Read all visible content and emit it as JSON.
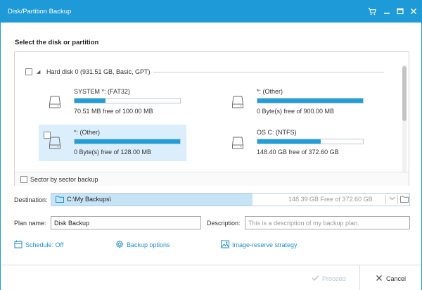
{
  "window": {
    "title": "Disk/Partition Backup",
    "accent_color": "#1d9ad7",
    "controls": [
      "cart-icon",
      "minimize-icon",
      "maximize-icon",
      "close-icon"
    ]
  },
  "section_title": "Select the disk or partition",
  "disk": {
    "label": "Hard disk 0 (931.51 GB, Basic, GPT)",
    "partitions": [
      {
        "name": "SYSTEM *: (FAT32)",
        "free": "70.51 MB free of 100.00 MB",
        "used_fraction": 0.29,
        "selected": false
      },
      {
        "name": "*: (Other)",
        "free": "0 Byte(s) free of 900.00 MB",
        "used_fraction": 1.0,
        "selected": false
      },
      {
        "name": "*: (Other)",
        "free": "0 Byte(s) free of 128.00 MB",
        "used_fraction": 1.0,
        "selected": true
      },
      {
        "name": "OS C: (NTFS)",
        "free": "148.40 GB free of 372.60 GB",
        "used_fraction": 0.6,
        "selected": false
      }
    ]
  },
  "sector_backup_label": "Sector by sector backup",
  "destination": {
    "label": "Destination:",
    "path": "C:\\My Backups\\",
    "free": "148.39 GB Free of 372.60 GB"
  },
  "plan": {
    "name_label": "Plan name:",
    "name_value": "Disk Backup",
    "description_label": "Description:",
    "description_placeholder": "This is a description of my backup plan."
  },
  "options": {
    "schedule": "Schedule: Off",
    "backup_options": "Backup options",
    "image_strategy": "Image-reserve strategy"
  },
  "footer": {
    "proceed": "Proceed",
    "cancel": "Cancel"
  }
}
